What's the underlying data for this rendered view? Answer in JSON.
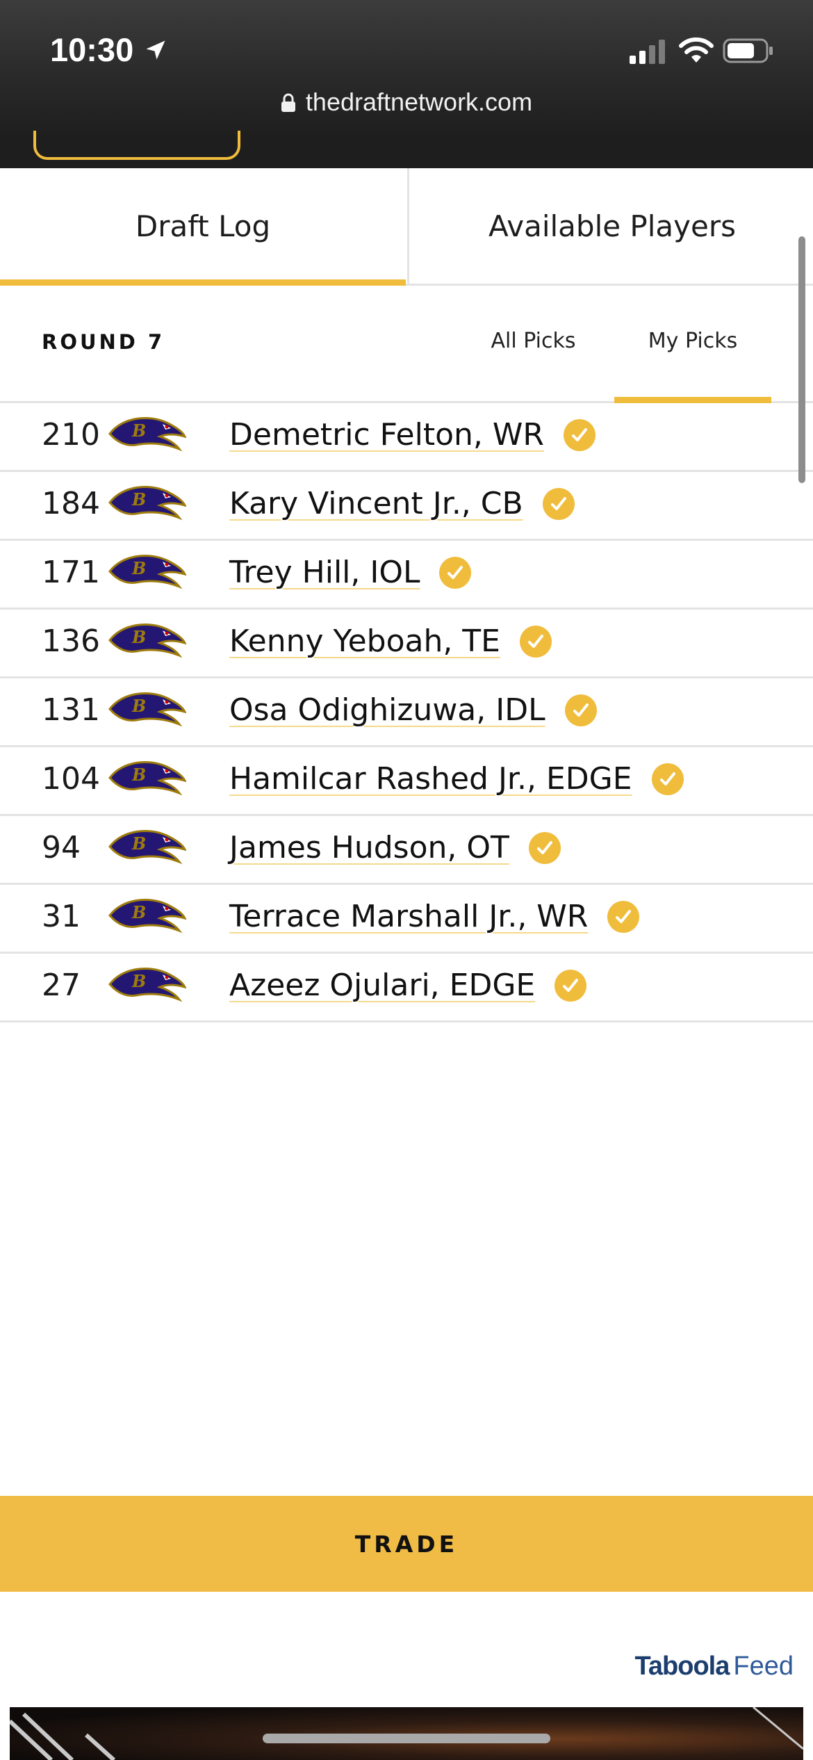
{
  "status_bar": {
    "time": "10:30",
    "icons": [
      "location-arrow-icon",
      "cellular-signal-icon",
      "wifi-icon",
      "battery-icon"
    ]
  },
  "browser": {
    "url": "thedraftnetwork.com",
    "lock_icon": "lock-icon"
  },
  "tabs": [
    {
      "label": "Draft Log",
      "active": true
    },
    {
      "label": "Available Players",
      "active": false
    }
  ],
  "round": {
    "label": "ROUND 7"
  },
  "filters": {
    "all_picks": "All Picks",
    "my_picks": "My Picks",
    "active": "my_picks"
  },
  "team": {
    "logo_icon": "ravens-logo-icon"
  },
  "picks": [
    {
      "number": "210",
      "player": "Demetric Felton, WR"
    },
    {
      "number": "184",
      "player": "Kary Vincent Jr., CB"
    },
    {
      "number": "171",
      "player": "Trey Hill, IOL"
    },
    {
      "number": "136",
      "player": "Kenny Yeboah, TE"
    },
    {
      "number": "131",
      "player": "Osa Odighizuwa, IDL"
    },
    {
      "number": "104",
      "player": "Hamilcar Rashed Jr., EDGE"
    },
    {
      "number": "94",
      "player": "James Hudson, OT"
    },
    {
      "number": "31",
      "player": "Terrace Marshall Jr., WR"
    },
    {
      "number": "27",
      "player": "Azeez Ojulari, EDGE"
    }
  ],
  "trade": {
    "label": "TRADE"
  },
  "taboola": {
    "brand": "Taboola",
    "feed": "Feed"
  },
  "colors": {
    "accent": "#f0bc3b",
    "trade_bg": "#f0bc45",
    "divider": "#e3e3e3",
    "topbar": "#2a2a2a"
  }
}
